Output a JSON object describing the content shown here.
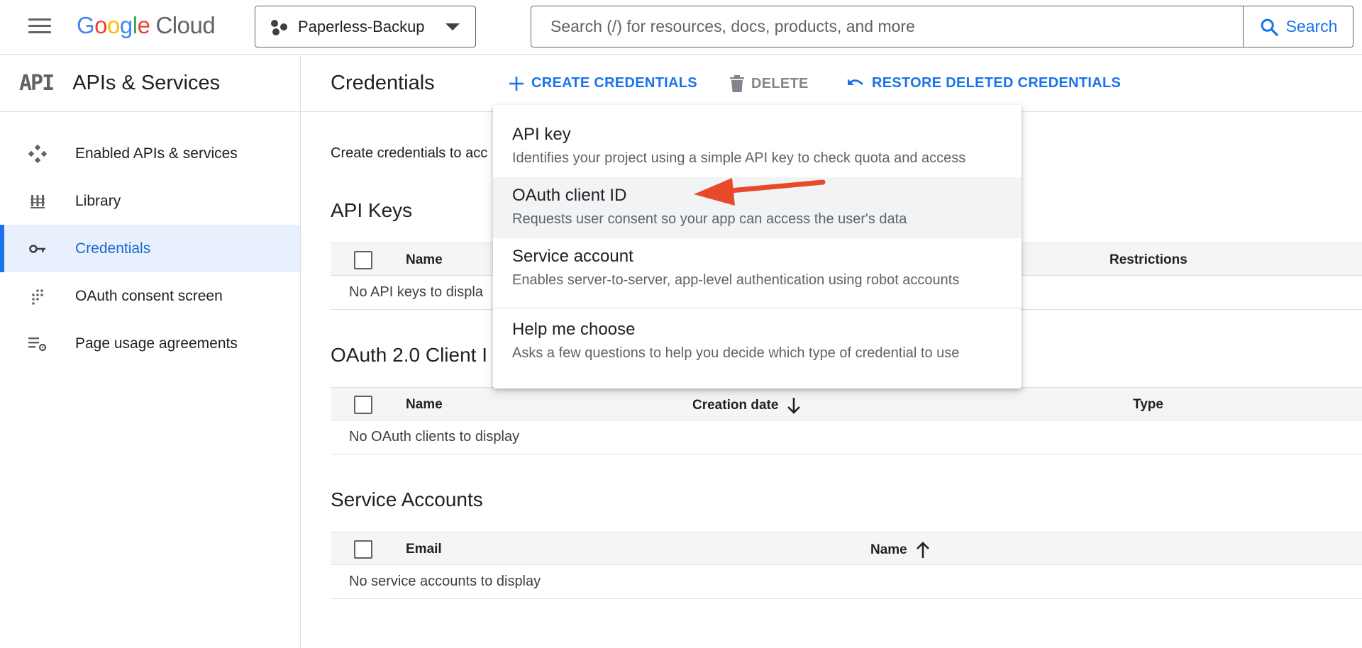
{
  "header": {
    "logo_letters": [
      "G",
      "o",
      "o",
      "g",
      "l",
      "e"
    ],
    "logo_cloud": "Cloud",
    "project_name": "Paperless-Backup",
    "search_placeholder": "Search (/) for resources, docs, products, and more",
    "search_button": "Search",
    "colors": {
      "brand_blue": "#1a73e8",
      "google_blue": "#4285f4",
      "google_red": "#ea4335",
      "google_yellow": "#fbbc05",
      "google_green": "#34a853"
    }
  },
  "sidebar": {
    "icon_text": "API",
    "title": "APIs & Services",
    "items": [
      {
        "label": "Enabled APIs & services",
        "icon": "diamond-grid-icon"
      },
      {
        "label": "Library",
        "icon": "library-icon"
      },
      {
        "label": "Credentials",
        "icon": "key-icon",
        "active": true
      },
      {
        "label": "OAuth consent screen",
        "icon": "dots-grid-icon"
      },
      {
        "label": "Page usage agreements",
        "icon": "list-settings-icon"
      }
    ]
  },
  "main": {
    "title": "Credentials",
    "actions": {
      "create": "CREATE CREDENTIALS",
      "delete": "DELETE",
      "restore": "RESTORE DELETED CREDENTIALS"
    },
    "intro": "Create credentials to acc",
    "api_keys": {
      "title": "API Keys",
      "columns": [
        "Name",
        "Restrictions"
      ],
      "empty": "No API keys to displa"
    },
    "oauth_clients": {
      "title": "OAuth 2.0 Client I",
      "columns": [
        "Name",
        "Creation date",
        "Type"
      ],
      "empty": "No OAuth clients to display"
    },
    "service_accounts": {
      "title": "Service Accounts",
      "columns": [
        "Email",
        "Name"
      ],
      "empty": "No service accounts to display"
    }
  },
  "menu": {
    "items": [
      {
        "title": "API key",
        "desc": "Identifies your project using a simple API key to check quota and access"
      },
      {
        "title": "OAuth client ID",
        "desc": "Requests user consent so your app can access the user's data",
        "highlighted": true
      },
      {
        "title": "Service account",
        "desc": "Enables server-to-server, app-level authentication using robot accounts"
      },
      {
        "title": "Help me choose",
        "desc": "Asks a few questions to help you decide which type of credential to use"
      }
    ]
  },
  "annotation": {
    "arrow_color": "#e8492b",
    "points_to": "OAuth client ID"
  }
}
